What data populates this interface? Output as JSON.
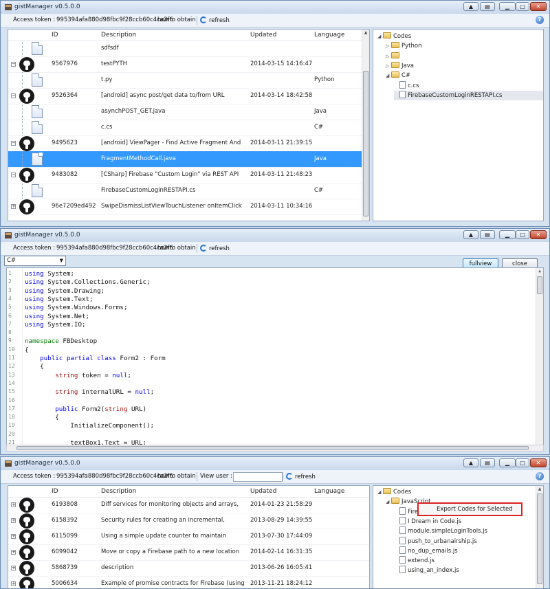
{
  "app_title": "gistManager v0.5.0.0",
  "toolbar": {
    "access_token_label": "Access token :",
    "access_token_value": "995394afa880d98fbc9f28ccb60c4ca2f6",
    "howto_label": "howto obtain",
    "refresh_label": "refresh",
    "view_user_label": "View user :",
    "help_glyph": "?"
  },
  "grid_columns": {
    "id": "ID",
    "description": "Description",
    "updated": "Updated",
    "language": "Language"
  },
  "window1": {
    "rows": [
      {
        "type": "file",
        "id": "",
        "description": "sdfsdf",
        "updated": "",
        "language": ""
      },
      {
        "type": "gist",
        "id": "9567976",
        "description": "testPYTH",
        "updated": "2014-03-15 14:16:47",
        "language": ""
      },
      {
        "type": "file",
        "id": "",
        "description": "t.py",
        "updated": "",
        "language": "Python"
      },
      {
        "type": "gist",
        "id": "9526364",
        "description": "[android] async post/get data to/from URL",
        "updated": "2014-03-14 18:42:58",
        "language": ""
      },
      {
        "type": "file",
        "id": "",
        "description": "asynchPOST_GET.java",
        "updated": "",
        "language": "Java"
      },
      {
        "type": "file",
        "id": "",
        "description": "c.cs",
        "updated": "",
        "language": "C#"
      },
      {
        "type": "gist",
        "id": "9495623",
        "description": "[android] ViewPager - Find Active Fragment And",
        "updated": "2014-03-11 21:39:15",
        "language": ""
      },
      {
        "type": "file",
        "id": "",
        "description": "FragmentMethodCall.java",
        "updated": "",
        "language": "Java",
        "selected": true
      },
      {
        "type": "gist",
        "id": "9483082",
        "description": "[CSharp] Firebase \"Custom Login\" via REST API",
        "updated": "2014-03-11 21:48:23",
        "language": ""
      },
      {
        "type": "file",
        "id": "",
        "description": "FirebaseCustomLoginRESTAPI.cs",
        "updated": "",
        "language": "C#"
      },
      {
        "type": "gist",
        "id": "96e7209ed492",
        "description": "SwipeDismissListViewTouchListener onItemClick",
        "updated": "2014-03-11 10:34:16",
        "language": ""
      }
    ],
    "tree": [
      {
        "label": "Codes",
        "level": 0,
        "kind": "folder",
        "tri": "◢"
      },
      {
        "label": "Python",
        "level": 1,
        "kind": "folder",
        "tri": "▷"
      },
      {
        "label": "",
        "level": 1,
        "kind": "folder",
        "tri": "▷"
      },
      {
        "label": "Java",
        "level": 1,
        "kind": "folder",
        "tri": "▷"
      },
      {
        "label": "C#",
        "level": 1,
        "kind": "folder",
        "tri": "◢"
      },
      {
        "label": "c.cs",
        "level": 2,
        "kind": "file",
        "tri": ""
      },
      {
        "label": "FirebaseCustomLoginRESTAPI.cs",
        "level": 2,
        "kind": "file",
        "tri": "",
        "selected": true
      }
    ]
  },
  "window2": {
    "language_select": "C#",
    "fullview_label": "fullview",
    "close_label": "close",
    "code_lines": [
      [
        {
          "t": "using",
          "c": "kw"
        },
        {
          "t": " System;"
        }
      ],
      [
        {
          "t": "using",
          "c": "kw"
        },
        {
          "t": " System.Collections.Generic;"
        }
      ],
      [
        {
          "t": "using",
          "c": "kw"
        },
        {
          "t": " System.Drawing;"
        }
      ],
      [
        {
          "t": "using",
          "c": "kw"
        },
        {
          "t": " System.Text;"
        }
      ],
      [
        {
          "t": "using",
          "c": "kw"
        },
        {
          "t": " System.Windows.Forms;"
        }
      ],
      [
        {
          "t": "using",
          "c": "kw"
        },
        {
          "t": " System.Net;"
        }
      ],
      [
        {
          "t": "using",
          "c": "kw"
        },
        {
          "t": " System.IO;"
        }
      ],
      [
        {
          "t": ""
        }
      ],
      [
        {
          "t": "namespace",
          "c": "ns"
        },
        {
          "t": " FBDesktop"
        }
      ],
      [
        {
          "t": "{"
        }
      ],
      [
        {
          "t": "    "
        },
        {
          "t": "public partial class",
          "c": "kw"
        },
        {
          "t": " Form2 : Form"
        }
      ],
      [
        {
          "t": "    {"
        }
      ],
      [
        {
          "t": "        "
        },
        {
          "t": "string",
          "c": "ty"
        },
        {
          "t": " token = "
        },
        {
          "t": "null",
          "c": "kw"
        },
        {
          "t": ";"
        }
      ],
      [
        {
          "t": ""
        }
      ],
      [
        {
          "t": "        "
        },
        {
          "t": "string",
          "c": "ty"
        },
        {
          "t": " internalURL = "
        },
        {
          "t": "null",
          "c": "kw"
        },
        {
          "t": ";"
        }
      ],
      [
        {
          "t": ""
        }
      ],
      [
        {
          "t": "        "
        },
        {
          "t": "public",
          "c": "kw"
        },
        {
          "t": " Form2("
        },
        {
          "t": "string",
          "c": "ty"
        },
        {
          "t": " URL)"
        }
      ],
      [
        {
          "t": "        {"
        }
      ],
      [
        {
          "t": "            InitializeComponent();"
        }
      ],
      [
        {
          "t": ""
        }
      ],
      [
        {
          "t": "            textBox1.Text = URL;"
        }
      ]
    ],
    "line_numbers": [
      "1",
      "2",
      "3",
      "4",
      "5",
      "6",
      "7",
      "8",
      "9",
      "10",
      "11",
      "12",
      "13",
      "14",
      "15",
      "16",
      "17",
      "18",
      "19",
      "20",
      "21"
    ]
  },
  "window3": {
    "rows": [
      {
        "id": "6193808",
        "description": "Diff services for monitoring objects and arrays,",
        "updated": "2014-01-23 21:58:29"
      },
      {
        "id": "6158392",
        "description": "Security rules for creating an incremental,",
        "updated": "2013-08-29 14:39:55"
      },
      {
        "id": "6115099",
        "description": "Using a simple update counter to maintain",
        "updated": "2013-07-30 17:44:09"
      },
      {
        "id": "6099042",
        "description": "Move or copy a Firebase path to a new location",
        "updated": "2014-02-14 16:31:35"
      },
      {
        "id": "5868739",
        "description": "description",
        "updated": "2013-06-26 16:05:41"
      },
      {
        "id": "5006634",
        "description": "Example of promise contracts for Firebase (using",
        "updated": "2013-11-21 18:24:12"
      }
    ],
    "tree": [
      {
        "label": "Codes",
        "level": 0,
        "kind": "folder",
        "tri": "◢"
      },
      {
        "label": "JavaScript",
        "level": 1,
        "kind": "folder",
        "tri": "◢"
      },
      {
        "label": "FirebaseMonitor.js",
        "level": 2,
        "kind": "file"
      },
      {
        "label": "I Dream in Code.js",
        "level": 2,
        "kind": "file"
      },
      {
        "label": "module.simpleLoginTools.js",
        "level": 2,
        "kind": "file"
      },
      {
        "label": "push_to_urbanairship.js",
        "level": 2,
        "kind": "file"
      },
      {
        "label": "no_dup_emails.js",
        "level": 2,
        "kind": "file"
      },
      {
        "label": "extend.js",
        "level": 2,
        "kind": "file"
      },
      {
        "label": "using_an_index.js",
        "level": 2,
        "kind": "file"
      }
    ],
    "context_menu_item": "Export Codes for Selected"
  }
}
